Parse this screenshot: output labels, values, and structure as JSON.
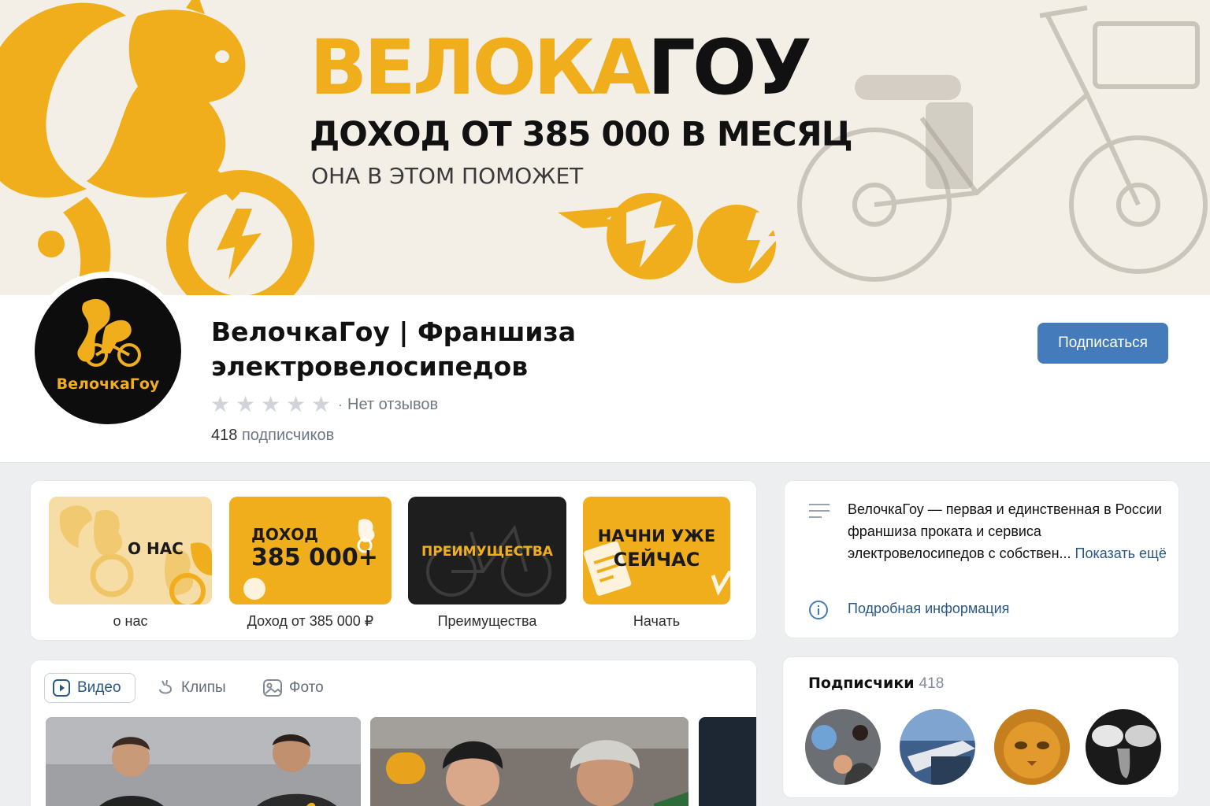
{
  "cover": {
    "title_part1": "ВЕЛОКА",
    "title_part2": "ГОУ",
    "subtitle": "ДОХОД ОТ 385 000 В МЕСЯЦ",
    "tagline": "ОНА В ЭТОМ ПОМОЖЕТ"
  },
  "profile": {
    "avatar_label": "ВелочкаГоу",
    "name": "ВелочкаГоу | Франшиза электровелосипедов",
    "rating_stars": 0,
    "reviews": "Нет отзывов",
    "subscribers_count": "418",
    "subscribers_label": "подписчиков",
    "subscribe_button": "Подписаться"
  },
  "links": [
    {
      "tile_text": "О НАС",
      "caption": "о нас"
    },
    {
      "tile_text_1": "ДОХОД",
      "tile_text_2": "385 000+",
      "caption": "Доход от 385 000 ₽"
    },
    {
      "tile_text": "ПРЕИМУЩЕСТВА",
      "caption": "Преимущества"
    },
    {
      "tile_text_1": "НАЧНИ УЖЕ",
      "tile_text_2": "СЕЙЧАС",
      "caption": "Начать"
    }
  ],
  "about": {
    "description": "ВелочкаГоу — первая  и  единственная в России франшиза проката и сервиса электровелосипедов с собствен...",
    "show_more": "Показать ещё",
    "details_link": "Подробная информация"
  },
  "media_tabs": [
    {
      "label": "Видео",
      "icon": "video-icon",
      "active": true
    },
    {
      "label": "Клипы",
      "icon": "clips-icon",
      "active": false
    },
    {
      "label": "Фото",
      "icon": "photo-icon",
      "active": false
    }
  ],
  "followers": {
    "title": "Подписчики",
    "count": "418"
  },
  "colors": {
    "brand_yellow": "#f0ae1c",
    "vk_blue": "#447bba",
    "link_blue": "#2a5885"
  }
}
